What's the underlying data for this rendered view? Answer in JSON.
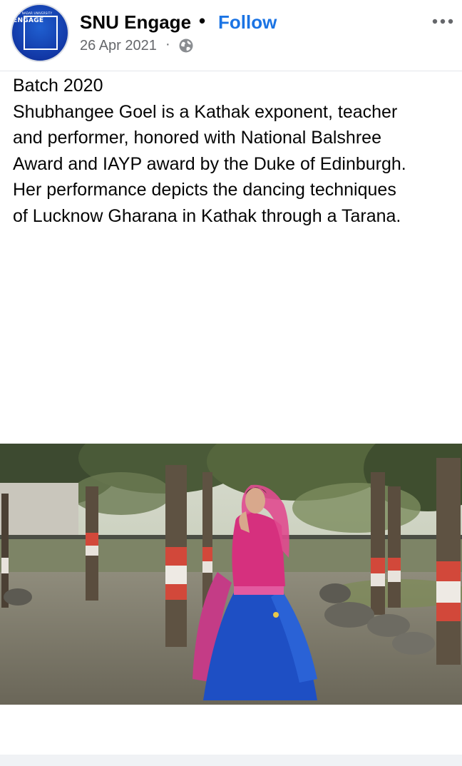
{
  "header": {
    "page_name": "SNU Engage",
    "separator": "•",
    "follow_label": "Follow",
    "date": "26 Apr 2021",
    "date_separator": "·",
    "privacy_icon": "globe-icon",
    "more_icon": "more-options-icon"
  },
  "avatar": {
    "brand_line": "SHIV NADAR UNIVERSITY",
    "brand_text": "ENGAGE"
  },
  "post": {
    "batch": "Batch 2020",
    "body": "Shubhangee Goel is a Kathak exponent, teacher\nand performer, honored with National Balshree\nAward and IAYP award by the Duke of Edinburgh.\nHer performance depicts the dancing techniques\nof Lucknow Gharana in Kathak through a Tarana."
  },
  "colors": {
    "link": "#1b74e4",
    "text": "#050505",
    "secondary": "#65676b",
    "avatar_bg": "#1238a6"
  }
}
